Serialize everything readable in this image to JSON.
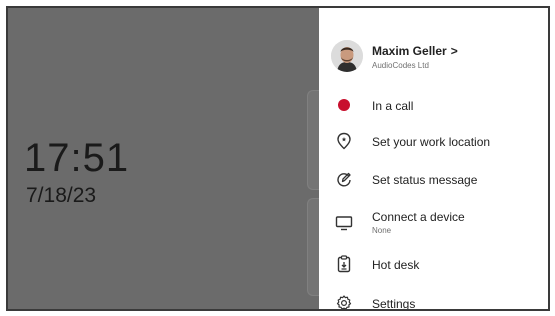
{
  "home": {
    "time": "17:51",
    "date": "7/18/23"
  },
  "profile": {
    "name": "Maxim Geller",
    "chevron": ">",
    "organization": "AudioCodes Ltd"
  },
  "menu": [
    {
      "label": "In a call",
      "icon": "status-dot-icon",
      "color": "#c8102e"
    },
    {
      "label": "Set your work location",
      "icon": "location-pin-icon"
    },
    {
      "label": "Set status message",
      "icon": "edit-status-icon"
    },
    {
      "label": "Connect a device",
      "sublabel": "None",
      "icon": "monitor-icon"
    },
    {
      "label": "Hot desk",
      "icon": "hot-desk-icon"
    },
    {
      "label": "Settings",
      "icon": "gear-icon"
    }
  ]
}
